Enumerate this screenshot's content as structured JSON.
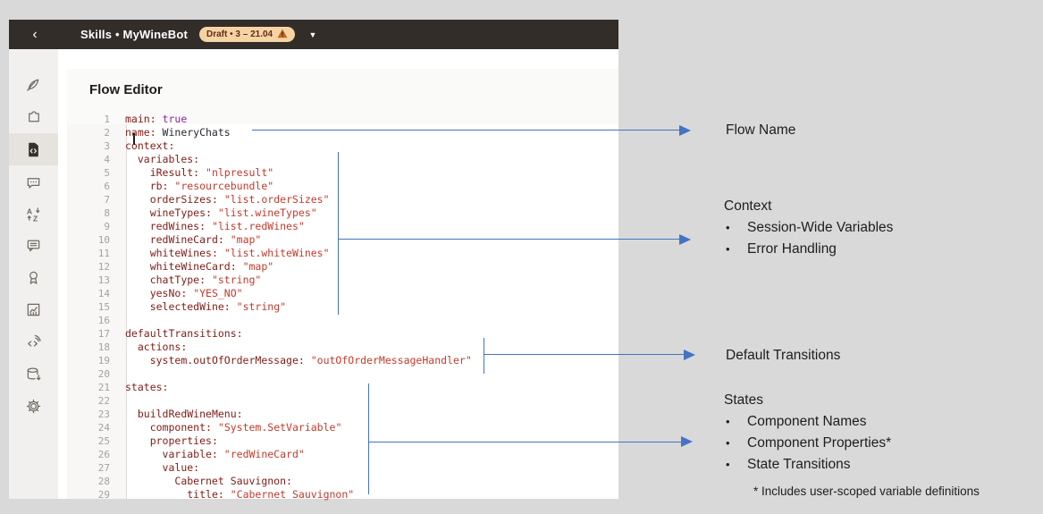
{
  "topbar": {
    "back": "‹",
    "title": "Skills • MyWineBot",
    "badge": "Draft • 3 – 21.04",
    "warning_icon": "warning-triangle-icon",
    "caret": "▼"
  },
  "sidebar": {
    "items": [
      {
        "icon": "quill-icon",
        "selected": false
      },
      {
        "icon": "puzzle-icon",
        "selected": false
      },
      {
        "icon": "flow-code-icon",
        "selected": true
      },
      {
        "icon": "chat-dots-icon",
        "selected": false
      },
      {
        "icon": "translate-sort-icon",
        "selected": false
      },
      {
        "icon": "chat-lines-icon",
        "selected": false
      },
      {
        "icon": "ribbon-icon",
        "selected": false
      },
      {
        "icon": "insights-chart-icon",
        "selected": false
      },
      {
        "icon": "code-signal-icon",
        "selected": false
      },
      {
        "icon": "database-export-icon",
        "selected": false
      },
      {
        "icon": "settings-gear-icon",
        "selected": false
      }
    ]
  },
  "editor": {
    "title": "Flow Editor",
    "lines": [
      {
        "n": 1,
        "seg": [
          {
            "c": "key",
            "t": "main:"
          },
          {
            "c": "plain",
            "t": " "
          },
          {
            "c": "bool",
            "t": "true"
          }
        ]
      },
      {
        "n": 2,
        "seg": [
          {
            "c": "key",
            "t": "name:"
          },
          {
            "c": "plain",
            "t": " WineryChats"
          }
        ]
      },
      {
        "n": 3,
        "seg": [
          {
            "c": "key",
            "t": "context:"
          }
        ]
      },
      {
        "n": 4,
        "seg": [
          {
            "c": "plain",
            "t": "  "
          },
          {
            "c": "key",
            "t": "variables:"
          }
        ]
      },
      {
        "n": 5,
        "seg": [
          {
            "c": "plain",
            "t": "    "
          },
          {
            "c": "key",
            "t": "iResult:"
          },
          {
            "c": "plain",
            "t": " "
          },
          {
            "c": "str",
            "t": "\"nlpresult\""
          }
        ]
      },
      {
        "n": 6,
        "seg": [
          {
            "c": "plain",
            "t": "    "
          },
          {
            "c": "key",
            "t": "rb:"
          },
          {
            "c": "plain",
            "t": " "
          },
          {
            "c": "str",
            "t": "\"resourcebundle\""
          }
        ]
      },
      {
        "n": 7,
        "seg": [
          {
            "c": "plain",
            "t": "    "
          },
          {
            "c": "key",
            "t": "orderSizes:"
          },
          {
            "c": "plain",
            "t": " "
          },
          {
            "c": "str",
            "t": "\"list.orderSizes\""
          }
        ]
      },
      {
        "n": 8,
        "seg": [
          {
            "c": "plain",
            "t": "    "
          },
          {
            "c": "key",
            "t": "wineTypes:"
          },
          {
            "c": "plain",
            "t": " "
          },
          {
            "c": "str",
            "t": "\"list.wineTypes\""
          }
        ]
      },
      {
        "n": 9,
        "seg": [
          {
            "c": "plain",
            "t": "    "
          },
          {
            "c": "key",
            "t": "redWines:"
          },
          {
            "c": "plain",
            "t": " "
          },
          {
            "c": "str",
            "t": "\"list.redWines\""
          }
        ]
      },
      {
        "n": 10,
        "seg": [
          {
            "c": "plain",
            "t": "    "
          },
          {
            "c": "key",
            "t": "redWineCard:"
          },
          {
            "c": "plain",
            "t": " "
          },
          {
            "c": "str",
            "t": "\"map\""
          }
        ]
      },
      {
        "n": 11,
        "seg": [
          {
            "c": "plain",
            "t": "    "
          },
          {
            "c": "key",
            "t": "whiteWines:"
          },
          {
            "c": "plain",
            "t": " "
          },
          {
            "c": "str",
            "t": "\"list.whiteWines\""
          }
        ]
      },
      {
        "n": 12,
        "seg": [
          {
            "c": "plain",
            "t": "    "
          },
          {
            "c": "key",
            "t": "whiteWineCard:"
          },
          {
            "c": "plain",
            "t": " "
          },
          {
            "c": "str",
            "t": "\"map\""
          }
        ]
      },
      {
        "n": 13,
        "seg": [
          {
            "c": "plain",
            "t": "    "
          },
          {
            "c": "key",
            "t": "chatType:"
          },
          {
            "c": "plain",
            "t": " "
          },
          {
            "c": "str",
            "t": "\"string\""
          }
        ]
      },
      {
        "n": 14,
        "seg": [
          {
            "c": "plain",
            "t": "    "
          },
          {
            "c": "key",
            "t": "yesNo:"
          },
          {
            "c": "plain",
            "t": " "
          },
          {
            "c": "str",
            "t": "\"YES_NO\""
          }
        ]
      },
      {
        "n": 15,
        "seg": [
          {
            "c": "plain",
            "t": "    "
          },
          {
            "c": "key",
            "t": "selectedWine:"
          },
          {
            "c": "plain",
            "t": " "
          },
          {
            "c": "str",
            "t": "\"string\""
          }
        ]
      },
      {
        "n": 16,
        "seg": []
      },
      {
        "n": 17,
        "seg": [
          {
            "c": "key",
            "t": "defaultTransitions:"
          }
        ]
      },
      {
        "n": 18,
        "seg": [
          {
            "c": "plain",
            "t": "  "
          },
          {
            "c": "key",
            "t": "actions:"
          }
        ]
      },
      {
        "n": 19,
        "seg": [
          {
            "c": "plain",
            "t": "    "
          },
          {
            "c": "key",
            "t": "system.outOfOrderMessage:"
          },
          {
            "c": "plain",
            "t": " "
          },
          {
            "c": "str",
            "t": "\"outOfOrderMessageHandler\""
          }
        ]
      },
      {
        "n": 20,
        "seg": []
      },
      {
        "n": 21,
        "seg": [
          {
            "c": "key",
            "t": "states:"
          }
        ]
      },
      {
        "n": 22,
        "seg": []
      },
      {
        "n": 23,
        "seg": [
          {
            "c": "plain",
            "t": "  "
          },
          {
            "c": "key",
            "t": "buildRedWineMenu:"
          }
        ]
      },
      {
        "n": 24,
        "seg": [
          {
            "c": "plain",
            "t": "    "
          },
          {
            "c": "key",
            "t": "component:"
          },
          {
            "c": "plain",
            "t": " "
          },
          {
            "c": "str",
            "t": "\"System.SetVariable\""
          }
        ]
      },
      {
        "n": 25,
        "seg": [
          {
            "c": "plain",
            "t": "    "
          },
          {
            "c": "key",
            "t": "properties:"
          }
        ]
      },
      {
        "n": 26,
        "seg": [
          {
            "c": "plain",
            "t": "      "
          },
          {
            "c": "key",
            "t": "variable:"
          },
          {
            "c": "plain",
            "t": " "
          },
          {
            "c": "str",
            "t": "\"redWineCard\""
          }
        ]
      },
      {
        "n": 27,
        "seg": [
          {
            "c": "plain",
            "t": "      "
          },
          {
            "c": "key",
            "t": "value:"
          }
        ]
      },
      {
        "n": 28,
        "seg": [
          {
            "c": "plain",
            "t": "        "
          },
          {
            "c": "key",
            "t": "Cabernet Sauvignon:"
          }
        ]
      },
      {
        "n": 29,
        "seg": [
          {
            "c": "plain",
            "t": "          "
          },
          {
            "c": "key",
            "t": "title:"
          },
          {
            "c": "plain",
            "t": " "
          },
          {
            "c": "str",
            "t": "\"Cabernet Sauvignon\""
          }
        ]
      }
    ]
  },
  "annotations": {
    "flow_name": "Flow Name",
    "context_title": "Context",
    "context_bullets": [
      "Session-Wide Variables",
      "Error Handling"
    ],
    "default_transitions": "Default Transitions",
    "states_title": "States",
    "states_bullets": [
      "Component Names",
      "Component Properties*",
      "State Transitions"
    ],
    "footnote": "* Includes user-scoped variable definitions"
  },
  "colors": {
    "outer_background": "#d9d9d9",
    "topbar": "#322d29",
    "sidebar": "#f2f0ee",
    "sidebar_selected": "#e6e3df",
    "badge_background": "#f5d4a4",
    "badge_text": "#652a1c",
    "warning_orange": "#c4641f",
    "yaml_key": "#801c15",
    "yaml_string": "#c33a2c",
    "yaml_boolean": "#8e24aa",
    "line_number": "#a5a19d",
    "callout_blue": "#4472c4"
  }
}
